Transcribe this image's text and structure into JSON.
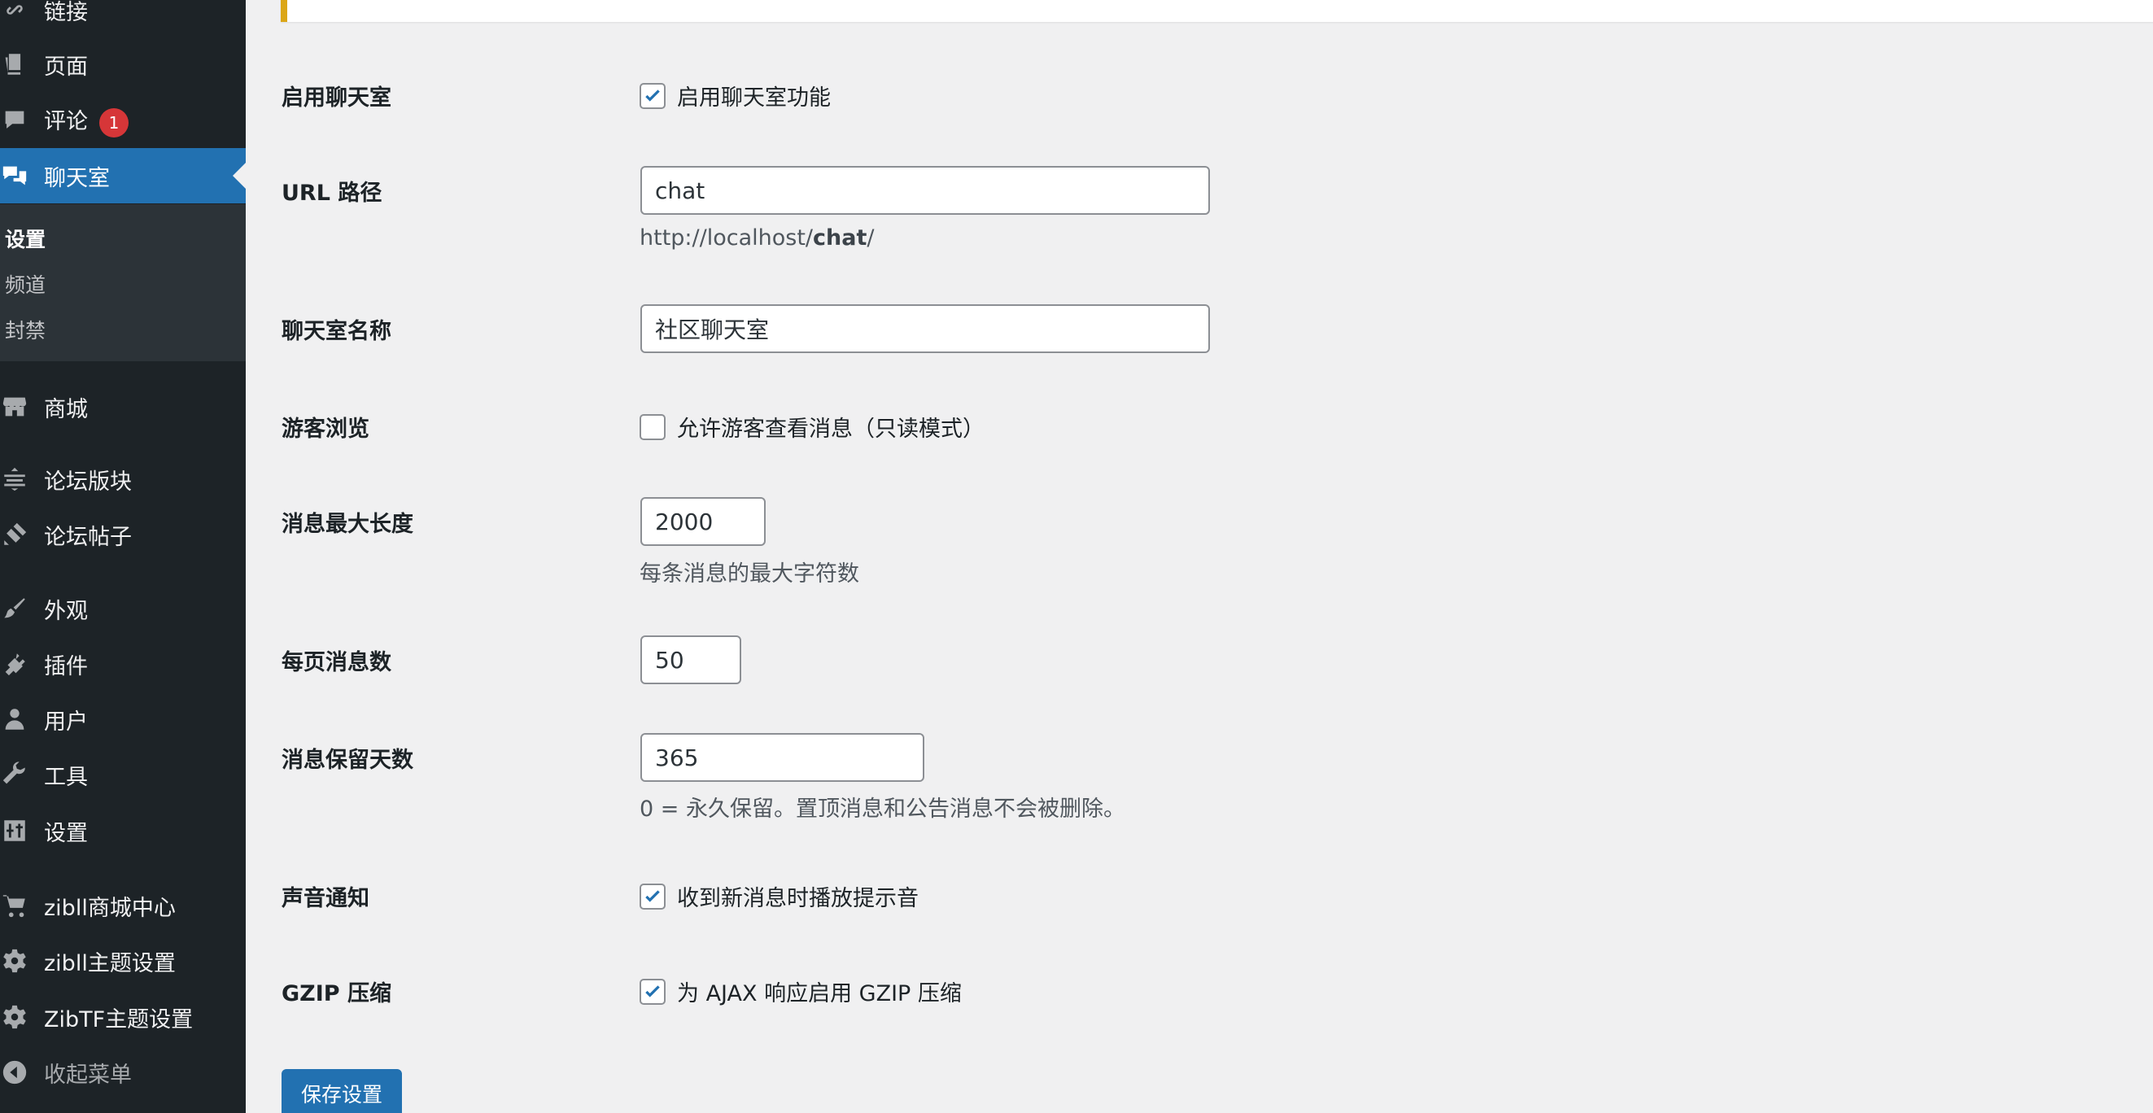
{
  "sidebar": {
    "items": [
      {
        "label": "链接",
        "icon": "link-icon"
      },
      {
        "label": "页面",
        "icon": "pages-icon"
      },
      {
        "label": "评论",
        "icon": "comments-icon",
        "badge": "1"
      },
      {
        "label": "聊天室",
        "icon": "chat-icon",
        "active": true
      },
      {
        "label": "商城",
        "icon": "store-icon"
      },
      {
        "label": "论坛版块",
        "icon": "forum-sections-icon"
      },
      {
        "label": "论坛帖子",
        "icon": "forum-posts-icon"
      },
      {
        "label": "外观",
        "icon": "appearance-icon"
      },
      {
        "label": "插件",
        "icon": "plugins-icon"
      },
      {
        "label": "用户",
        "icon": "users-icon"
      },
      {
        "label": "工具",
        "icon": "tools-icon"
      },
      {
        "label": "设置",
        "icon": "settings-icon"
      },
      {
        "label": "zibll商城中心",
        "icon": "cart-icon"
      },
      {
        "label": "zibll主题设置",
        "icon": "gear-icon"
      },
      {
        "label": "ZibTF主题设置",
        "icon": "gear-icon"
      },
      {
        "label": "收起菜单",
        "icon": "collapse-icon"
      }
    ],
    "submenu": [
      {
        "label": "设置",
        "current": true
      },
      {
        "label": "频道"
      },
      {
        "label": "封禁"
      }
    ]
  },
  "form": {
    "enable_chat": {
      "label": "启用聊天室",
      "checkbox_label": "启用聊天室功能",
      "checked": true
    },
    "url_path": {
      "label": "URL 路径",
      "value": "chat",
      "desc_prefix": "http://localhost/",
      "desc_bold": "chat",
      "desc_suffix": "/"
    },
    "chat_name": {
      "label": "聊天室名称",
      "value": "社区聊天室"
    },
    "guest_browse": {
      "label": "游客浏览",
      "checkbox_label": "允许游客查看消息（只读模式）",
      "checked": false
    },
    "max_length": {
      "label": "消息最大长度",
      "value": "2000",
      "desc": "每条消息的最大字符数"
    },
    "per_page": {
      "label": "每页消息数",
      "value": "50"
    },
    "retention_days": {
      "label": "消息保留天数",
      "value": "365",
      "desc": "0 = 永久保留。置顶消息和公告消息不会被删除。"
    },
    "sound": {
      "label": "声音通知",
      "checkbox_label": "收到新消息时播放提示音",
      "checked": true
    },
    "gzip": {
      "label": "GZIP 压缩",
      "checkbox_label": "为 AJAX 响应启用 GZIP 压缩",
      "checked": true
    }
  },
  "save_button": "保存设置",
  "colors": {
    "sidebar_bg": "#1d2327",
    "accent": "#2271b1",
    "badge": "#d63638",
    "notice_border": "#dba617"
  }
}
